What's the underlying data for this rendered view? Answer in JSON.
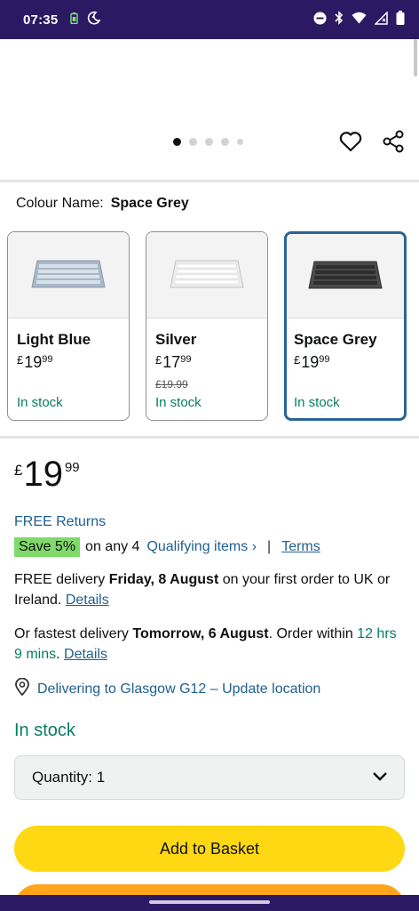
{
  "status_bar": {
    "time": "07:35",
    "left_icons": [
      "battery-saver-icon",
      "dnd-moon-icon"
    ],
    "right_icons": [
      "do-not-disturb-icon",
      "bluetooth-icon",
      "wifi-icon",
      "signal-icon",
      "battery-icon"
    ]
  },
  "gallery": {
    "dot_count": 5,
    "active_dot": 0,
    "icons": [
      "heart-icon",
      "share-icon"
    ]
  },
  "colour": {
    "label": "Colour Name:",
    "selected": "Space Grey"
  },
  "swatches": [
    {
      "name": "Light Blue",
      "currency": "£",
      "price_whole": "19",
      "price_fraction": "99",
      "strike_price": "",
      "stock": "In stock",
      "keyboard_color": "#a9b8c8",
      "selected": false
    },
    {
      "name": "Silver",
      "currency": "£",
      "price_whole": "17",
      "price_fraction": "99",
      "strike_price": "£19.99",
      "stock": "In stock",
      "keyboard_color": "#e6e6e6",
      "selected": false
    },
    {
      "name": "Space Grey",
      "currency": "£",
      "price_whole": "19",
      "price_fraction": "99",
      "strike_price": "",
      "stock": "In stock",
      "keyboard_color": "#4a4a4a",
      "selected": true
    }
  ],
  "price": {
    "currency": "£",
    "whole": "19",
    "fraction": "99"
  },
  "free_returns": "FREE Returns",
  "promo": {
    "badge": "Save 5%",
    "text": "on any 4",
    "qualifying": "Qualifying items",
    "qualifying_chevron": "›",
    "divider": "|",
    "terms": "Terms"
  },
  "delivery": {
    "prefix": "FREE delivery",
    "date": "Friday, 8 August",
    "suffix": "on your first order to UK or Ireland.",
    "details": "Details"
  },
  "fastest": {
    "prefix": "Or fastest delivery",
    "date": "Tomorrow, 6 August",
    "middle": ". Order within",
    "countdown": "12 hrs 9 mins",
    "end": ".",
    "details": "Details"
  },
  "location": {
    "text": "Delivering to Glasgow G12 – Update location",
    "icon": "location-pin-icon"
  },
  "availability": "In stock",
  "quantity": {
    "label": "Quantity:",
    "value": "1"
  },
  "buttons": {
    "add_to_basket": "Add to Basket"
  },
  "colors": {
    "status_bar": "#2b1a63",
    "link": "#1f5f8f",
    "stock_green": "#067d62",
    "add_to_basket": "#ffd814",
    "buy_now": "#ffa41c",
    "selected_border": "#2a6496",
    "save_badge": "#7fda69"
  }
}
